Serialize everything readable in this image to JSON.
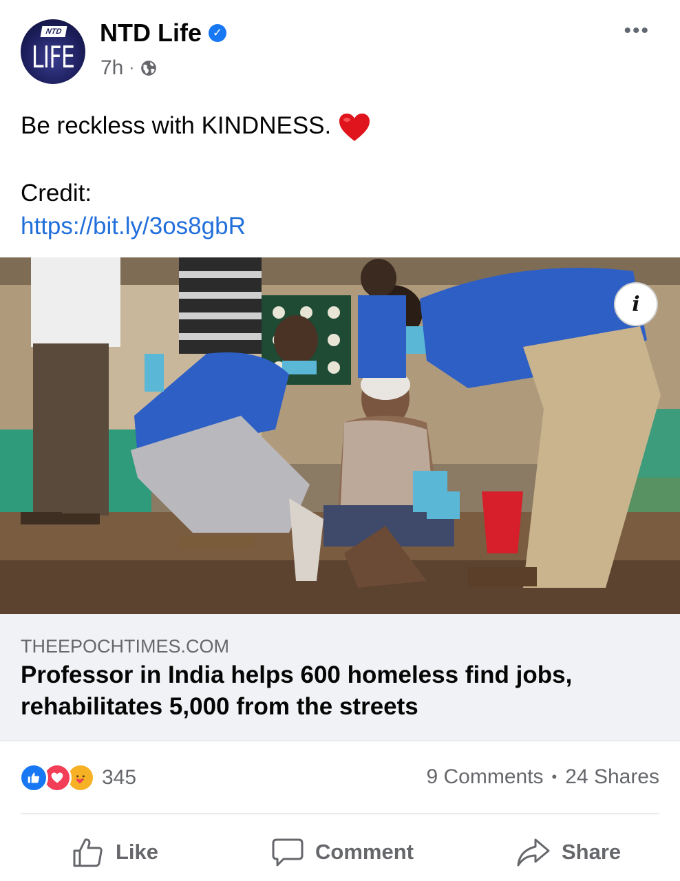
{
  "header": {
    "avatar_badge": "NTD",
    "avatar_wordmark": "LIFE",
    "page_name": "NTD Life",
    "verified_icon": "verified-check-icon",
    "time": "7h",
    "separator": "·",
    "audience_icon": "globe-icon",
    "more_label": "•••"
  },
  "post": {
    "text": "Be reckless with KINDNESS.",
    "emoji": "red-heart",
    "credit_label": "Credit:",
    "link": "https://bit.ly/3os8gbR"
  },
  "media": {
    "info_label": "i"
  },
  "preview": {
    "domain": "THEEPOCHTIMES.COM",
    "headline": "Professor in India helps 600 homeless find jobs, rehabilitates 5,000 from the streets"
  },
  "engagement": {
    "reaction_icons": [
      "like-reaction-icon",
      "love-reaction-icon",
      "care-reaction-icon"
    ],
    "reaction_count": "345",
    "comments": "9 Comments",
    "separator": "•",
    "shares": "24 Shares"
  },
  "actions": {
    "like": "Like",
    "comment": "Comment",
    "share": "Share"
  },
  "colors": {
    "link": "#216fdb",
    "like_blue": "#1877f2",
    "love_red": "#f33e58",
    "care_yellow": "#f7b125",
    "secondary_text": "#65676b"
  }
}
